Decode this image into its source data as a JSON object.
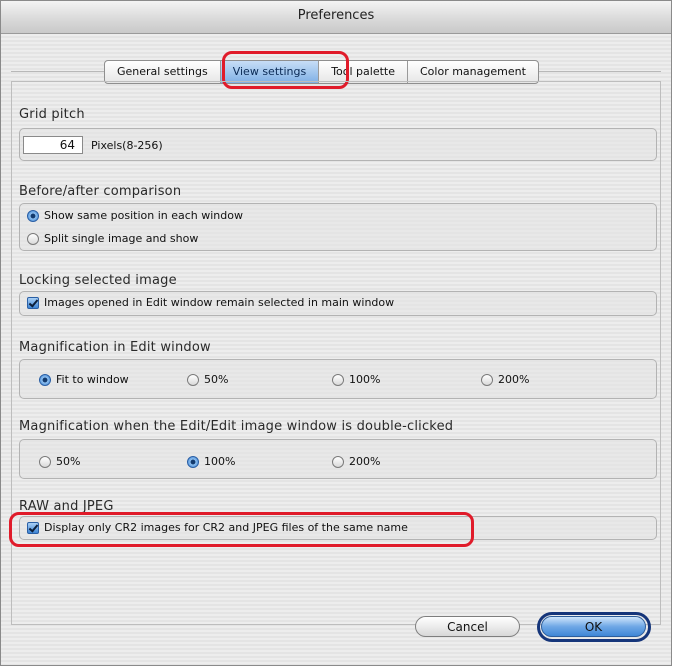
{
  "window": {
    "title": "Preferences"
  },
  "tabs": [
    {
      "label": "General settings",
      "active": false
    },
    {
      "label": "View settings",
      "active": true
    },
    {
      "label": "Tool palette",
      "active": false
    },
    {
      "label": "Color management",
      "active": false
    }
  ],
  "grid_pitch": {
    "title": "Grid pitch",
    "value": "64",
    "unit_label": "Pixels(8-256)"
  },
  "before_after": {
    "title": "Before/after comparison",
    "options": [
      {
        "label": "Show same position in each window",
        "selected": true
      },
      {
        "label": "Split single image and show",
        "selected": false
      }
    ]
  },
  "locking": {
    "title": "Locking selected image",
    "checkbox": {
      "label": "Images opened in Edit window remain selected in main window",
      "checked": true
    }
  },
  "magnification_edit": {
    "title": "Magnification in Edit window",
    "options": [
      {
        "label": "Fit to window",
        "selected": true
      },
      {
        "label": "50%",
        "selected": false
      },
      {
        "label": "100%",
        "selected": false
      },
      {
        "label": "200%",
        "selected": false
      }
    ]
  },
  "magnification_double_click": {
    "title": "Magnification when the Edit/Edit image window is double-clicked",
    "options": [
      {
        "label": "50%",
        "selected": false
      },
      {
        "label": "100%",
        "selected": true
      },
      {
        "label": "200%",
        "selected": false
      }
    ]
  },
  "raw_jpeg": {
    "title": "RAW and JPEG",
    "checkbox": {
      "label": "Display only CR2 images for CR2 and JPEG files of the same name",
      "checked": true
    }
  },
  "buttons": {
    "cancel": "Cancel",
    "ok": "OK"
  },
  "colors": {
    "highlight": "#e01b2a",
    "accent": "#3f86d6",
    "ok_ring": "#15357a"
  }
}
